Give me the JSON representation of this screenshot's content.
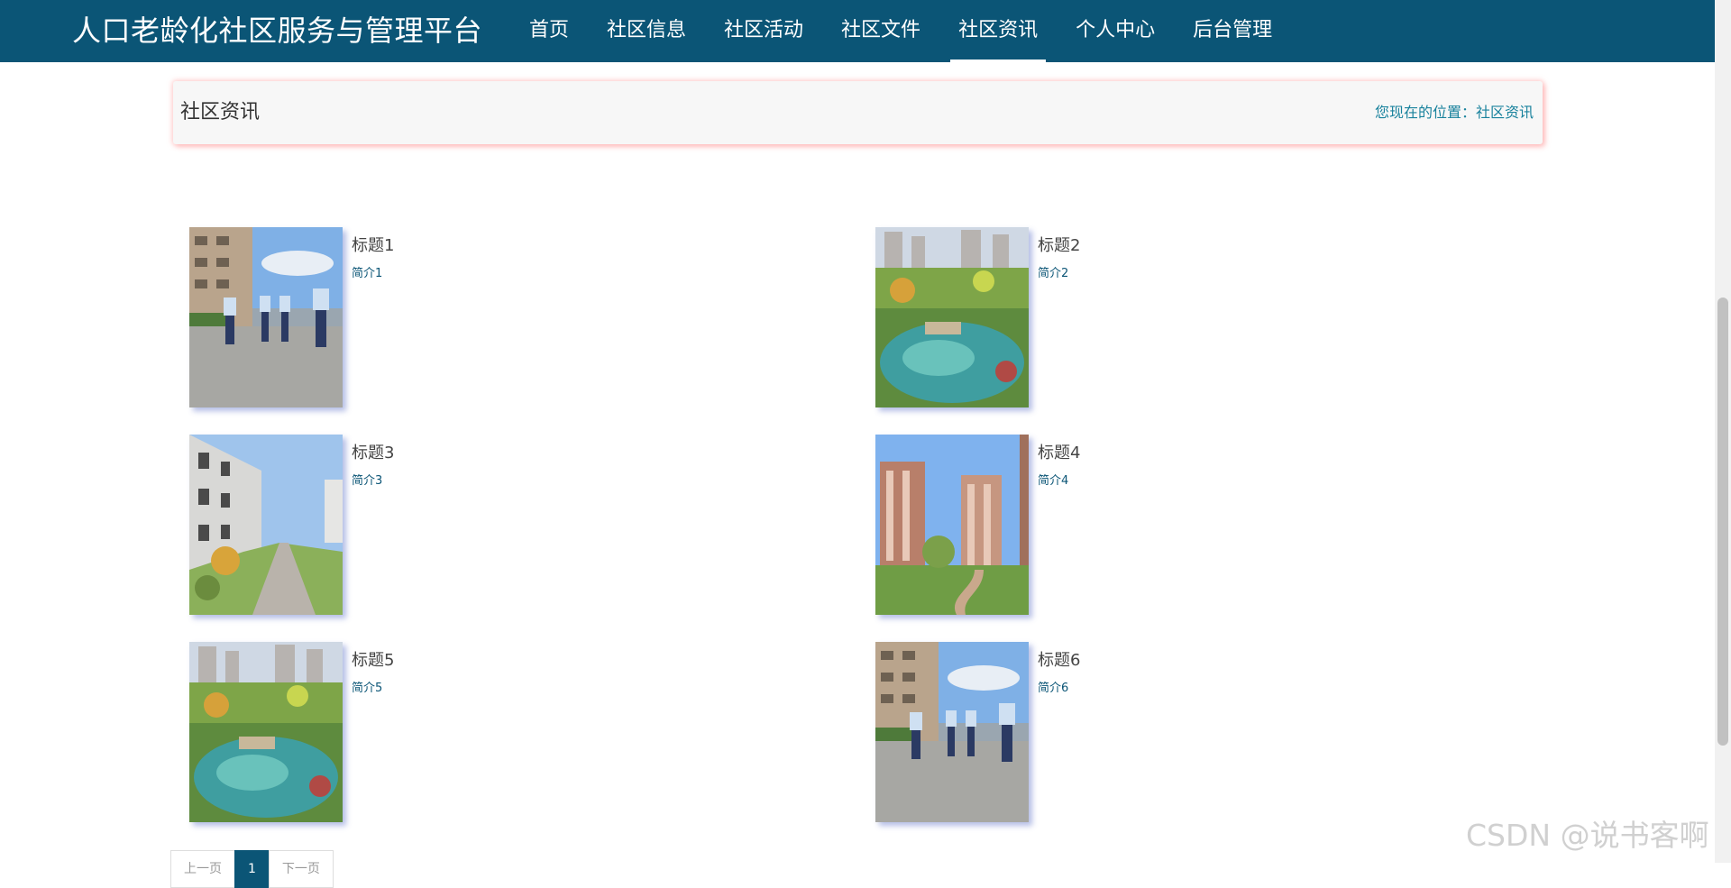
{
  "header": {
    "brand": "人口老龄化社区服务与管理平台",
    "nav": [
      {
        "label": "首页"
      },
      {
        "label": "社区信息"
      },
      {
        "label": "社区活动"
      },
      {
        "label": "社区文件"
      },
      {
        "label": "社区资讯",
        "active": true
      },
      {
        "label": "个人中心"
      },
      {
        "label": "后台管理"
      }
    ]
  },
  "page": {
    "title": "社区资讯",
    "breadcrumb_prefix": "您现在的位置：",
    "breadcrumb_current": "社区资讯"
  },
  "news": [
    {
      "title": "标题1",
      "intro": "简介1",
      "image": "people-walking-photo"
    },
    {
      "title": "标题2",
      "intro": "简介2",
      "image": "garden-pond-photo"
    },
    {
      "title": "标题3",
      "intro": "简介3",
      "image": "residential-path-photo"
    },
    {
      "title": "标题4",
      "intro": "简介4",
      "image": "towers-lawn-photo"
    },
    {
      "title": "标题5",
      "intro": "简介5",
      "image": "garden-pond-photo"
    },
    {
      "title": "标题6",
      "intro": "简介6",
      "image": "people-walking-photo"
    }
  ],
  "pagination": {
    "prev": "上一页",
    "current": "1",
    "next": "下一页"
  },
  "watermark": "CSDN @说书客啊",
  "colors": {
    "nav_bg": "#0b5576",
    "accent": "#19829d"
  }
}
